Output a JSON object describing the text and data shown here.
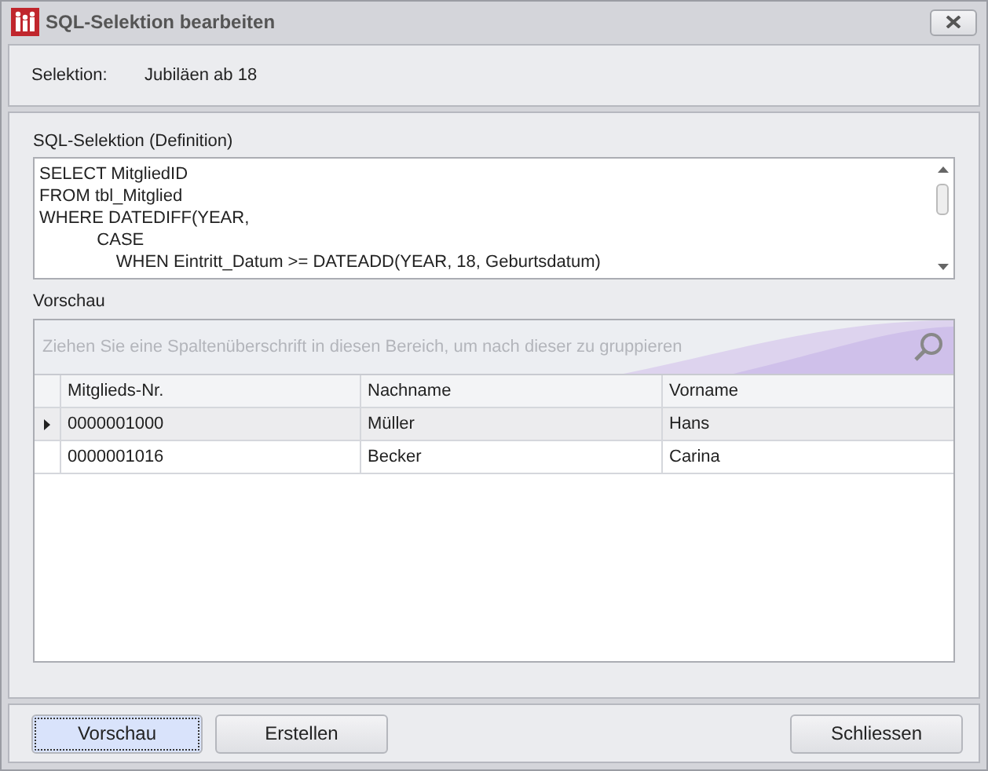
{
  "window": {
    "title": "SQL-Selektion bearbeiten"
  },
  "selection": {
    "label": "Selektion:",
    "value": "Jubiläen ab 18"
  },
  "definition": {
    "label": "SQL-Selektion (Definition)",
    "lines": [
      "SELECT MitgliedID",
      "FROM tbl_Mitglied",
      "WHERE DATEDIFF(YEAR,",
      "            CASE",
      "                WHEN Eintritt_Datum >= DATEADD(YEAR, 18, Geburtsdatum)"
    ]
  },
  "preview": {
    "label": "Vorschau",
    "group_panel_hint": "Ziehen Sie eine Spaltenüberschrift in diesen Bereich, um nach dieser zu gruppieren",
    "columns": [
      "Mitglieds-Nr.",
      "Nachname",
      "Vorname"
    ],
    "rows": [
      {
        "cells": [
          "0000001000",
          "Müller",
          "Hans"
        ],
        "selected": true
      },
      {
        "cells": [
          "0000001016",
          "Becker",
          "Carina"
        ],
        "selected": false
      }
    ]
  },
  "buttons": [
    {
      "label": "Vorschau",
      "focused": true
    },
    {
      "label": "Erstellen",
      "focused": false
    },
    {
      "label": "Schliessen",
      "focused": false
    }
  ]
}
